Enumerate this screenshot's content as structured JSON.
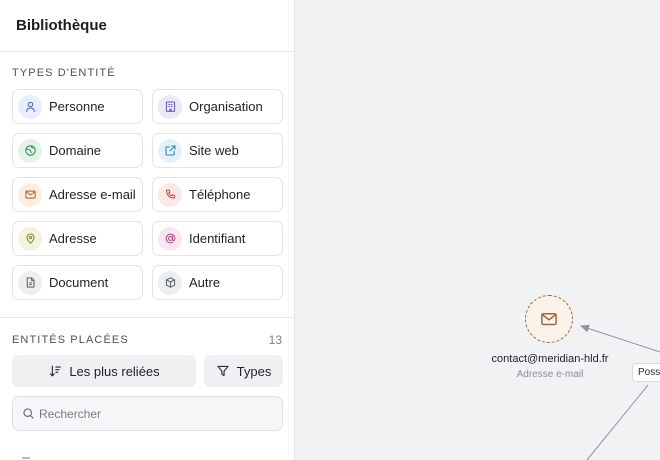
{
  "sidebar": {
    "title": "Bibliothèque",
    "types_heading": "TYPES D'ENTITÉ",
    "types": [
      {
        "label": "Personne",
        "icon": "person-icon",
        "color": "#4a73c9",
        "bg": "#e8eefb"
      },
      {
        "label": "Organisation",
        "icon": "building-icon",
        "color": "#6a58b0",
        "bg": "#ece9f7"
      },
      {
        "label": "Domaine",
        "icon": "globe-icon",
        "color": "#2f8a5c",
        "bg": "#e3f3ea"
      },
      {
        "label": "Site web",
        "icon": "external-link-icon",
        "color": "#2a88b8",
        "bg": "#e3f2fa"
      },
      {
        "label": "Adresse e-mail",
        "icon": "mail-icon",
        "color": "#b0682e",
        "bg": "#faeee3"
      },
      {
        "label": "Téléphone",
        "icon": "phone-icon",
        "color": "#c44a4a",
        "bg": "#fbe9e9"
      },
      {
        "label": "Adresse",
        "icon": "map-pin-icon",
        "color": "#8a8a2a",
        "bg": "#f5f3df"
      },
      {
        "label": "Identifiant",
        "icon": "at-sign-icon",
        "color": "#b04a8a",
        "bg": "#f8e7f1"
      },
      {
        "label": "Document",
        "icon": "file-text-icon",
        "color": "#5c6670",
        "bg": "#eceef0"
      },
      {
        "label": "Autre",
        "icon": "box-icon",
        "color": "#5c6670",
        "bg": "#eceef0"
      }
    ],
    "placed_heading": "ENTITÉS PLACÉES",
    "placed_count": "13",
    "sort_label": "Les plus reliées",
    "filter_label": "Types",
    "search_placeholder": "Rechercher"
  },
  "canvas": {
    "node": {
      "title": "contact@meridian-hld.fr",
      "subtitle": "Adresse e-mail",
      "icon": "mail-icon",
      "color": "#9b6a3a"
    },
    "edge_label": "Poss"
  }
}
